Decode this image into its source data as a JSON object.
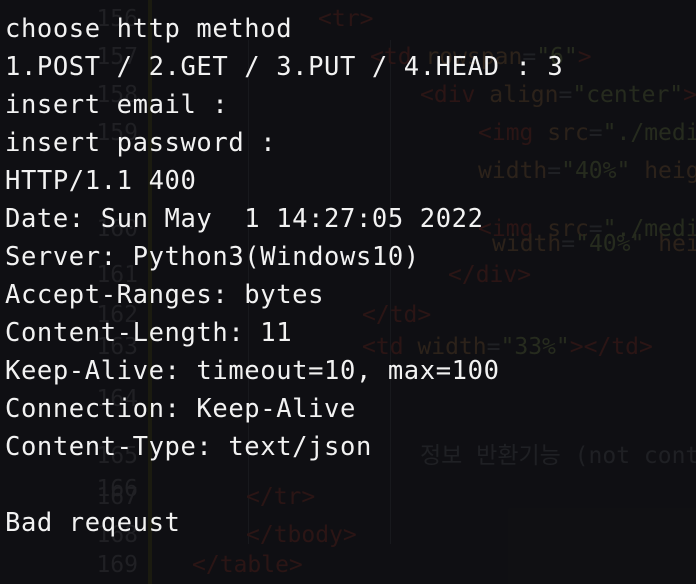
{
  "editor": {
    "lines": [
      {
        "num": "156",
        "tokens": [
          {
            "t": "<",
            "c": "tag"
          },
          {
            "t": "tr",
            "c": "tag"
          },
          {
            "t": ">",
            "c": "tag"
          }
        ]
      },
      {
        "num": "157",
        "tokens": [
          {
            "t": "<td ",
            "c": "tag"
          },
          {
            "t": "rowspan",
            "c": "attr"
          },
          {
            "t": "=",
            "c": "plain"
          },
          {
            "t": "\"6\"",
            "c": "val"
          },
          {
            "t": ">",
            "c": "tag"
          }
        ]
      },
      {
        "num": "158",
        "tokens": [
          {
            "t": "<div ",
            "c": "tag"
          },
          {
            "t": "align",
            "c": "attr"
          },
          {
            "t": "=",
            "c": "plain"
          },
          {
            "t": "\"center\"",
            "c": "val"
          },
          {
            "t": ">",
            "c": "tag"
          }
        ]
      },
      {
        "num": "159",
        "tokens": [
          {
            "t": "<img ",
            "c": "tag"
          },
          {
            "t": "src",
            "c": "attr"
          },
          {
            "t": "=",
            "c": "plain"
          },
          {
            "t": "\"./media",
            "c": "val"
          }
        ]
      },
      {
        "num": "",
        "tokens": [
          {
            "t": "width",
            "c": "attr"
          },
          {
            "t": "=",
            "c": "plain"
          },
          {
            "t": "\"40%\" ",
            "c": "val"
          },
          {
            "t": "height",
            "c": "attr"
          }
        ]
      },
      {
        "num": "160",
        "tokens": [
          {
            "t": "<img ",
            "c": "tag"
          },
          {
            "t": "src",
            "c": "attr"
          },
          {
            "t": "=",
            "c": "plain"
          },
          {
            "t": "\"./media",
            "c": "val"
          }
        ]
      },
      {
        "num": "",
        "tokens": [
          {
            "t": "width",
            "c": "attr"
          },
          {
            "t": "=",
            "c": "plain"
          },
          {
            "t": "\"40%\" ",
            "c": "val"
          },
          {
            "t": "height",
            "c": "attr"
          }
        ]
      },
      {
        "num": "161",
        "tokens": [
          {
            "t": "</div>",
            "c": "tag"
          }
        ]
      },
      {
        "num": "162",
        "tokens": [
          {
            "t": "</td>",
            "c": "tag"
          }
        ]
      },
      {
        "num": "163",
        "tokens": [
          {
            "t": "<td ",
            "c": "tag"
          },
          {
            "t": "width",
            "c": "attr"
          },
          {
            "t": "=",
            "c": "plain"
          },
          {
            "t": "\"33%\"",
            "c": "val"
          },
          {
            "t": "></td>",
            "c": "tag"
          }
        ]
      },
      {
        "num": "164",
        "tokens": []
      },
      {
        "num": "165",
        "tokens": [
          {
            "t": "정보 반환기능 (not conta",
            "c": "plain"
          }
        ]
      },
      {
        "num": "166",
        "tokens": []
      },
      {
        "num": "167",
        "tokens": [
          {
            "t": "</tr>",
            "c": "tag"
          }
        ]
      },
      {
        "num": "168",
        "tokens": [
          {
            "t": "</tbody>",
            "c": "tag"
          }
        ]
      },
      {
        "num": "169",
        "tokens": [
          {
            "t": "</table>",
            "c": "tag"
          }
        ]
      }
    ]
  },
  "terminal": {
    "lines": [
      "choose http method",
      "1.POST / 2.GET / 3.PUT / 4.HEAD : 3",
      "insert email :",
      "insert password :",
      "HTTP/1.1 400",
      "Date: Sun May  1 14:27:05 2022",
      "Server: Python3(Windows10)",
      "Accept-Ranges: bytes",
      "Content-Length: 11",
      "Keep-Alive: timeout=10, max=100",
      "Connection: Keep-Alive",
      "Content-Type: text/json",
      "",
      "Bad reqeust"
    ]
  }
}
